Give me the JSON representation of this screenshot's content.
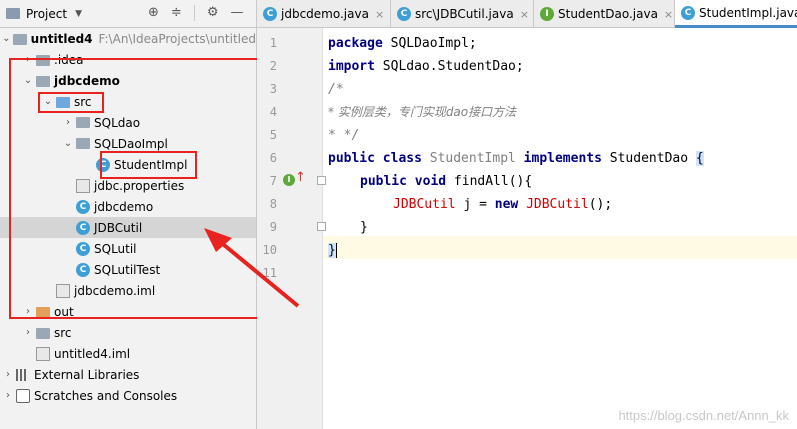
{
  "project_panel": {
    "title": "Project",
    "tree": [
      {
        "label": "untitled4",
        "path": "F:\\An\\IdeaProjects\\untitled",
        "bold": true
      },
      {
        "label": ".idea"
      },
      {
        "label": "jdbcdemo",
        "bold": true
      },
      {
        "label": "src"
      },
      {
        "label": "SQLdao"
      },
      {
        "label": "SQLDaoImpl"
      },
      {
        "label": "StudentImpl"
      },
      {
        "label": "jdbc.properties"
      },
      {
        "label": "jdbcdemo"
      },
      {
        "label": "JDBCutil"
      },
      {
        "label": "SQLutil"
      },
      {
        "label": "SQLutilTest"
      },
      {
        "label": "jdbcdemo.iml"
      },
      {
        "label": "out"
      },
      {
        "label": "src"
      },
      {
        "label": "untitled4.iml"
      },
      {
        "label": "External Libraries"
      },
      {
        "label": "Scratches and Consoles"
      }
    ]
  },
  "tabs": [
    {
      "label": "jdbcdemo.java",
      "icon": "class-icon"
    },
    {
      "label": "src\\JDBCutil.java",
      "icon": "class-icon"
    },
    {
      "label": "StudentDao.java",
      "icon": "interface-icon"
    },
    {
      "label": "StudentImpl.java",
      "icon": "class-icon",
      "active": true
    }
  ],
  "editor": {
    "line_numbers": [
      "1",
      "2",
      "3",
      "4",
      "5",
      "6",
      "7",
      "8",
      "9",
      "10",
      "11"
    ],
    "lines": {
      "l1_kw": "package",
      "l1_rest": " SQLDaoImpl;",
      "l2_kw": "import",
      "l2_rest": " SQLdao.StudentDao;",
      "l3": "/*",
      "l4": "* 实例层类，专门实现dao接口方法",
      "l5": "* */",
      "l6_kw1": "public class",
      "l6_name": " StudentImpl ",
      "l6_kw2": "implements",
      "l6_rest": " StudentDao ",
      "l6_brace": "{",
      "l7_kw": "public void",
      "l7_rest": " findAll(){",
      "l8_a": "JDBCutil",
      "l8_b": " j = ",
      "l8_kw": "new",
      "l8_c": " JDBCutil",
      "l8_d": "();",
      "l9": "}",
      "l10": "}"
    }
  },
  "watermark": "https://blog.csdn.net/Annn_kk",
  "colors": {
    "annotation": "#e8231f",
    "keyword": "#000080",
    "selection": "#d5d5d5"
  }
}
